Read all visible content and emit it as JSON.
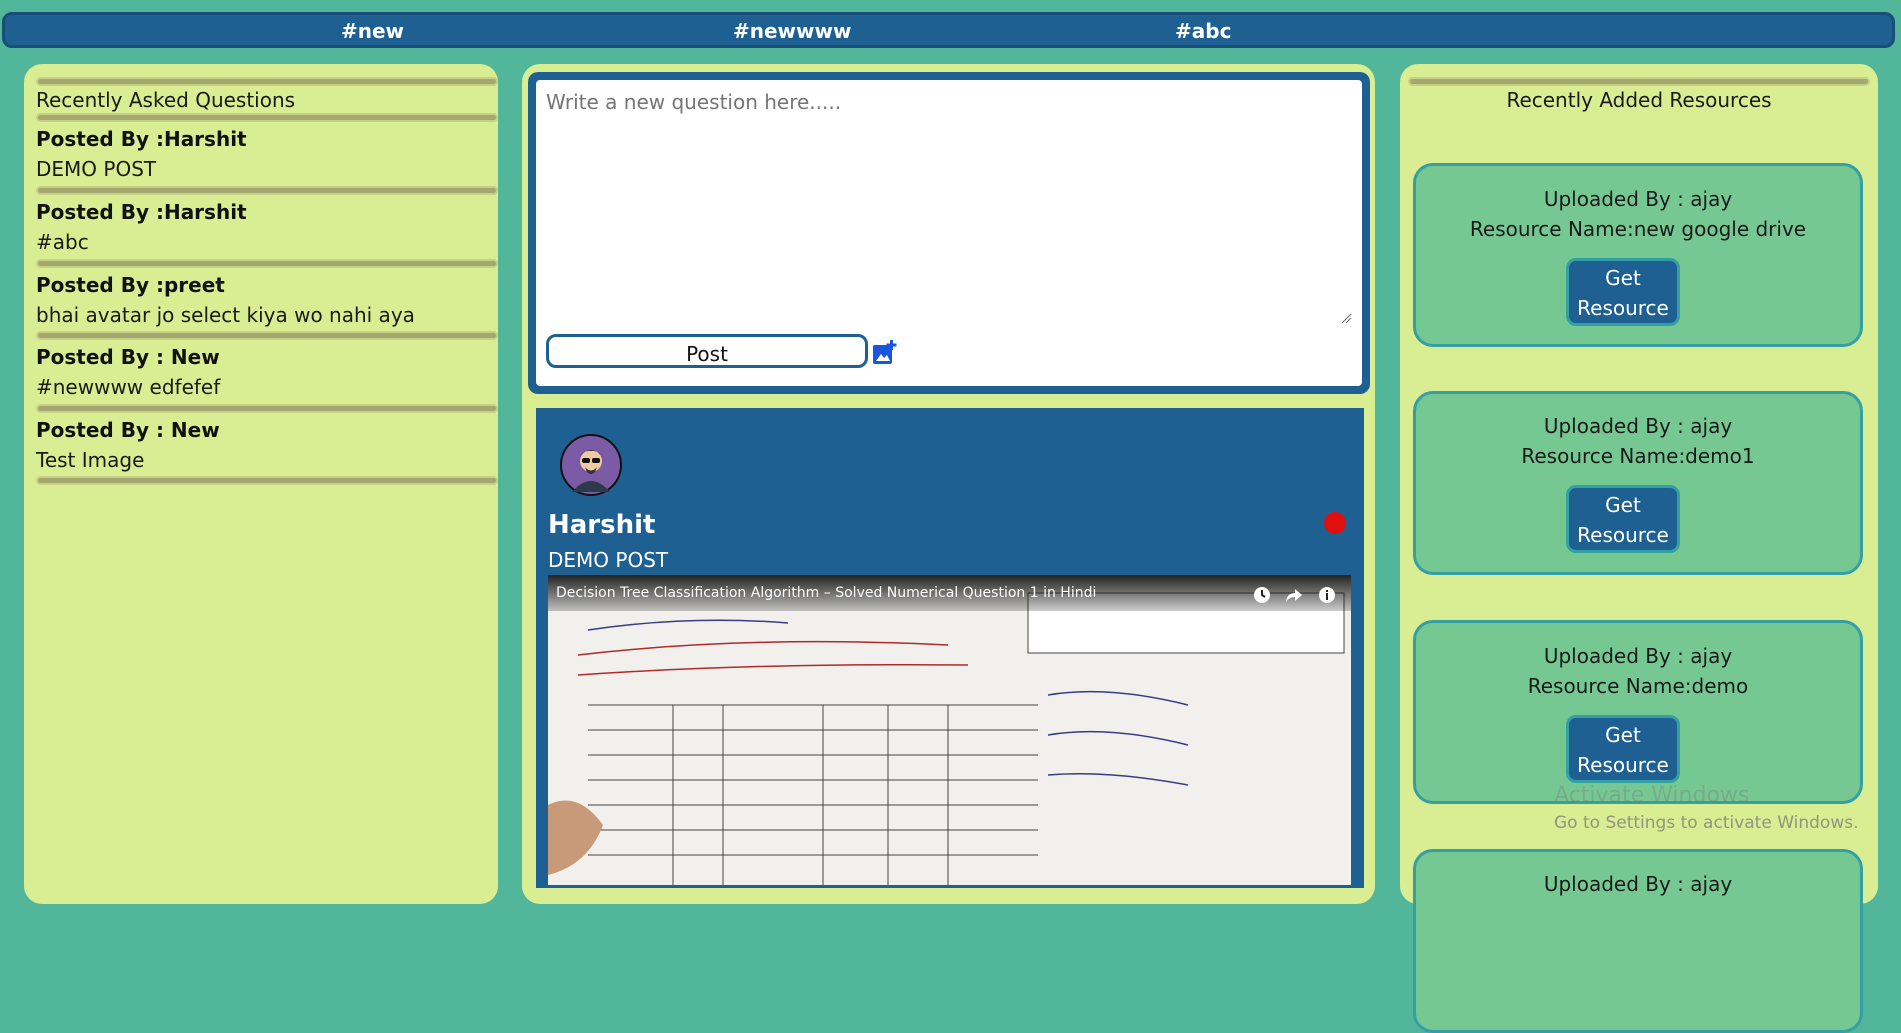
{
  "nav": {
    "tags": [
      "#new",
      "#newwww",
      "#abc"
    ]
  },
  "left": {
    "title": "Recently Asked Questions",
    "questions": [
      {
        "author": "Posted By :Harshit",
        "text": "DEMO POST"
      },
      {
        "author": "Posted By :Harshit",
        "text": "#abc"
      },
      {
        "author": "Posted By :preet",
        "text": "bhai avatar jo select kiya wo nahi aya"
      },
      {
        "author": "Posted By : New",
        "text": "#newwww edfefef"
      },
      {
        "author": "Posted By : New",
        "text": "Test Image"
      }
    ]
  },
  "composer": {
    "placeholder": "Write a new question here.....",
    "post_label": "Post"
  },
  "post": {
    "author": "Harshit",
    "body": "DEMO POST",
    "video_title": "Decision Tree Classification Algorithm – Solved Numerical Question 1 in Hindi"
  },
  "right": {
    "title": "Recently Added Resources",
    "resources": [
      {
        "uploader": "Uploaded By : ajay",
        "name": "Resource Name:new google drive",
        "button": "Get Resource"
      },
      {
        "uploader": "Uploaded By : ajay",
        "name": "Resource Name:demo1",
        "button": "Get Resource"
      },
      {
        "uploader": "Uploaded By : ajay",
        "name": "Resource Name:demo",
        "button": "Get Resource"
      },
      {
        "uploader": "Uploaded By : ajay",
        "name": "",
        "button": ""
      }
    ]
  },
  "watermark": {
    "line1": "Activate Windows",
    "line2": "Go to Settings to activate Windows."
  },
  "colors": {
    "page_bg": "#52b69a",
    "panel_bg": "#d9ed92",
    "primary": "#1e6091",
    "card_bg": "#76c893",
    "accent_red": "#e01010"
  }
}
